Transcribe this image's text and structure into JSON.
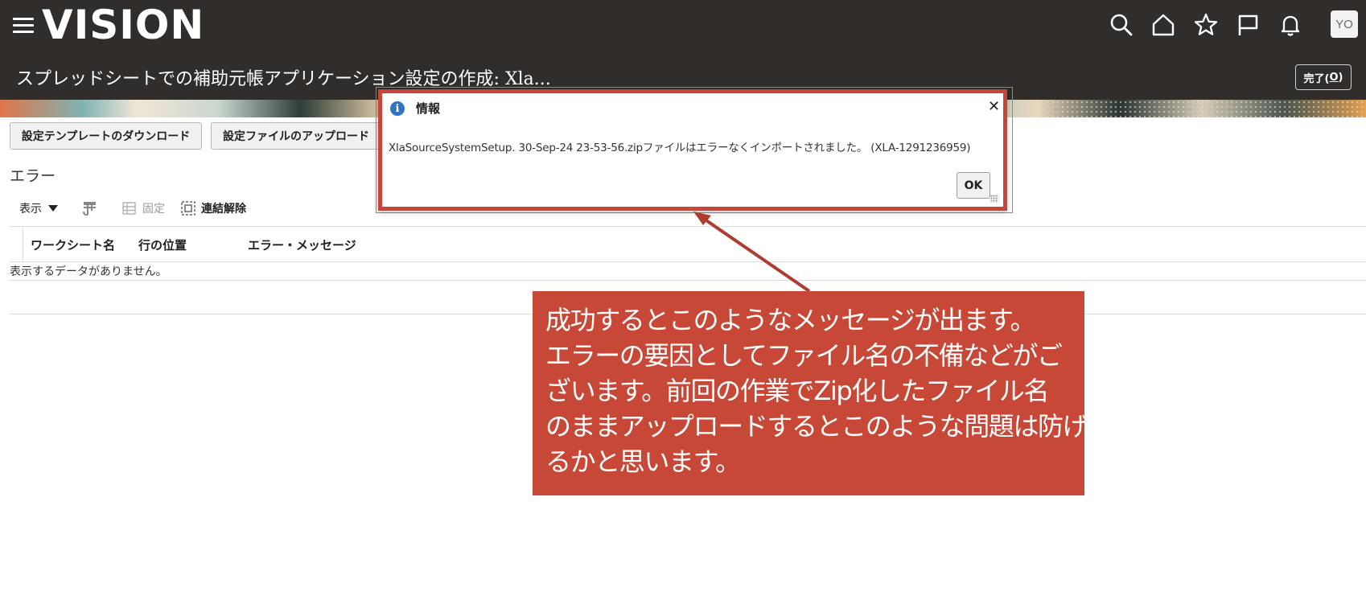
{
  "header": {
    "logo": "VISION",
    "page_title": "スプレッドシートでの補助元帳アプリケーション設定の作成: Xla...",
    "done_label": "完了(",
    "done_accel": "O",
    "done_close": ")",
    "avatar_initials": "YO",
    "icons": [
      "menu-icon",
      "search-icon",
      "home-icon",
      "star-icon",
      "flag-icon",
      "bell-icon"
    ]
  },
  "actions": {
    "download_template": "設定テンプレートのダウンロード",
    "upload_file": "設定ファイルのアップロード"
  },
  "errors_section": {
    "title": "エラー",
    "toolbar": {
      "view": "表示",
      "freeze": "固定",
      "detach": "連結解除"
    },
    "columns": [
      "ワークシート名",
      "行の位置",
      "エラー・メッセージ"
    ],
    "empty_message": "表示するデータがありません。"
  },
  "dialog": {
    "title": "情報",
    "message": "XlaSourceSystemSetup. 30-Sep-24 23-53-56.zipファイルはエラーなくインポートされました。 (XLA-1291236959)",
    "ok_label": "OK",
    "highlight_color": "#c8453a"
  },
  "callout": {
    "lines": [
      "成功するとこのようなメッセージが出ます。",
      "エラーの要因としてファイル名の不備などがご",
      "ざいます。前回の作業でZip化したファイル名",
      "のままアップロードするとこのような問題は防げ",
      "るかと思います。"
    ],
    "color": "#c84837"
  }
}
